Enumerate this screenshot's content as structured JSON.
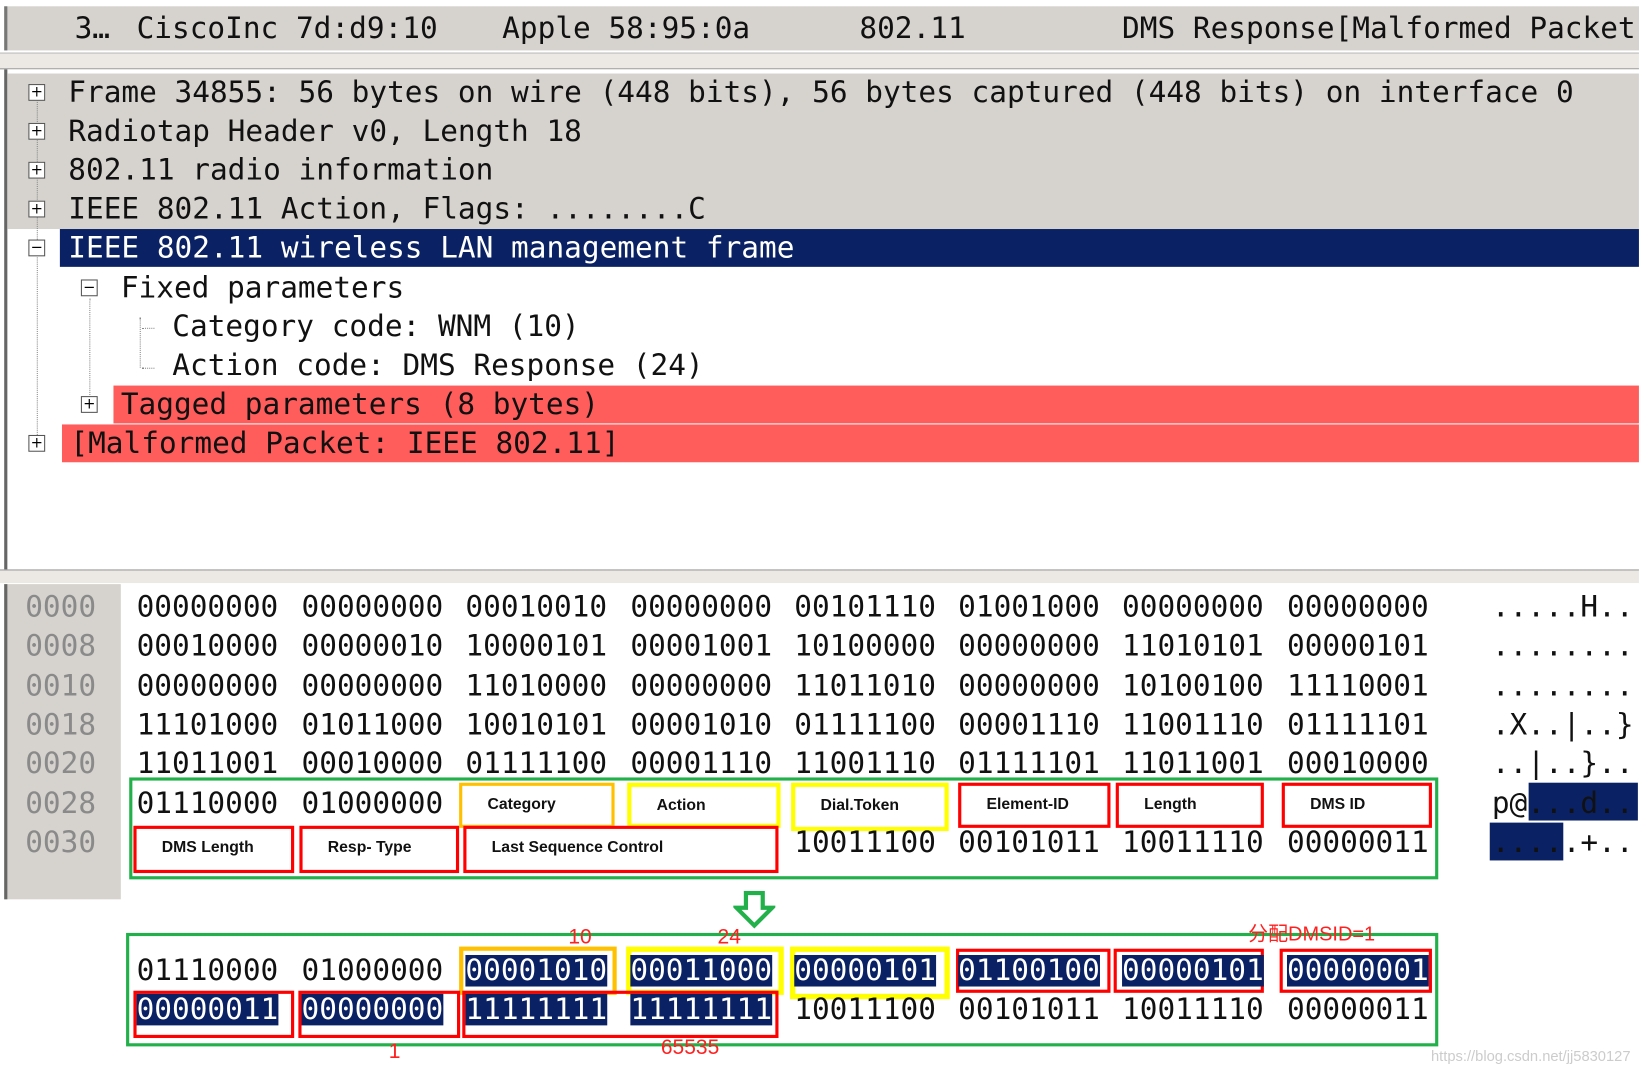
{
  "packet_list": {
    "no": "3…",
    "source": "CiscoInc 7d:d9:10",
    "destination": "Apple 58:95:0a",
    "protocol": "802.11",
    "info": "DMS Response[Malformed Packet"
  },
  "tree": [
    {
      "text": "Frame 34855: 56 bytes on wire (448 bits), 56 bytes captured (448 bits) on interface 0",
      "expander": "+"
    },
    {
      "text": "Radiotap Header v0, Length 18",
      "expander": "+"
    },
    {
      "text": "802.11 radio information",
      "expander": "+"
    },
    {
      "text": "IEEE 802.11 Action, Flags: ........C",
      "expander": "+"
    },
    {
      "text": "IEEE 802.11 wireless LAN management frame",
      "expander": "−"
    },
    {
      "text": "Fixed parameters",
      "expander": "−"
    },
    {
      "text": "Category code: WNM (10)"
    },
    {
      "text": "Action code: DMS Response (24)"
    },
    {
      "text": "Tagged parameters (8 bytes)",
      "expander": "+"
    },
    {
      "text": "[Malformed Packet: IEEE 802.11]",
      "expander": "+"
    }
  ],
  "hex": [
    {
      "offset": "0000",
      "bytes": [
        "00000000",
        "00000000",
        "00010010",
        "00000000",
        "00101110",
        "01001000",
        "00000000",
        "00000000"
      ],
      "ascii": ".....H.."
    },
    {
      "offset": "0008",
      "bytes": [
        "00010000",
        "00000010",
        "10000101",
        "00001001",
        "10100000",
        "00000000",
        "11010101",
        "00000101"
      ],
      "ascii": "........"
    },
    {
      "offset": "0010",
      "bytes": [
        "00000000",
        "00000000",
        "11010000",
        "00000000",
        "11011010",
        "00000000",
        "10100100",
        "11110001"
      ],
      "ascii": "........"
    },
    {
      "offset": "0018",
      "bytes": [
        "11101000",
        "01011000",
        "10010101",
        "00001010",
        "01111100",
        "00001110",
        "11001110",
        "01111101"
      ],
      "ascii": ".X..|..}"
    },
    {
      "offset": "0020",
      "bytes": [
        "11011001",
        "00010000",
        "01111100",
        "00001110",
        "11001110",
        "01111101",
        "11011001",
        "00010000"
      ],
      "ascii": "..|..}.."
    },
    {
      "offset": "0028",
      "bytes": [
        "01110000",
        "01000000",
        "",
        "",
        "",
        "",
        "",
        ""
      ],
      "ascii": "p@...d.."
    },
    {
      "offset": "0030",
      "bytes": [
        "",
        "",
        "",
        "",
        "10011100",
        "00101011",
        "10011110",
        "00000011"
      ],
      "ascii": ".....+.."
    }
  ],
  "field_labels": {
    "category": "Category",
    "action": "Action",
    "dial_token": "Dial.Token",
    "element_id": "Element-ID",
    "length": "Length",
    "dms_id": "DMS ID",
    "dms_length": "DMS Length",
    "resp_type": "Resp- Type",
    "last_seq": "Last Sequence Control"
  },
  "decoded": {
    "row1": [
      "01110000",
      "01000000",
      "00001010",
      "00011000",
      "00000101",
      "01100100",
      "00000101",
      "00000001"
    ],
    "row2": [
      "00000011",
      "00000000",
      "11111111",
      "11111111",
      "10011100",
      "00101011",
      "10011110",
      "00000011"
    ]
  },
  "annotations": {
    "category_value": "10",
    "action_value": "24",
    "dms_id_note": "分配DMSID=1",
    "resp_type_value": "1",
    "last_seq_value": "65535"
  },
  "watermark": "https://blog.csdn.net/jj5830127",
  "colors": {
    "selection": "#0a2163",
    "malformed": "#ff5c5c",
    "group_box": "#22b04b",
    "field_box": "#ff0000",
    "category_box": "#ffc000",
    "action_box": "#ffff00"
  }
}
